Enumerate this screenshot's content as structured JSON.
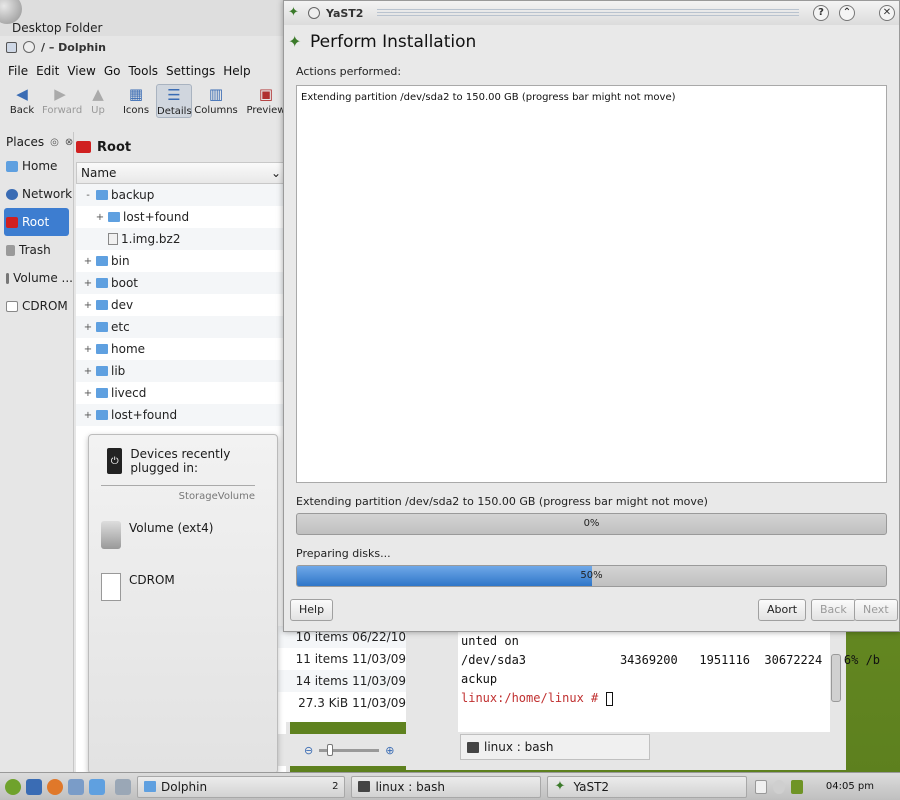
{
  "desktop_folder": {
    "title": "Desktop Folder"
  },
  "dolphin": {
    "title": "/ – Dolphin",
    "menu": [
      "File",
      "Edit",
      "View",
      "Go",
      "Tools",
      "Settings",
      "Help"
    ],
    "toolbar": {
      "back": "Back",
      "forward": "Forward",
      "up": "Up",
      "icons": "Icons",
      "details": "Details",
      "columns": "Columns",
      "preview": "Preview"
    },
    "places": {
      "title": "Places",
      "items": [
        "Home",
        "Network",
        "Root",
        "Trash",
        "Volume ...",
        "CDROM"
      ]
    },
    "location": "Root",
    "column_header": "Name",
    "tree": [
      {
        "exp": "-",
        "name": "backup",
        "type": "folder",
        "indent": 0
      },
      {
        "exp": "+",
        "name": "lost+found",
        "type": "folder",
        "indent": 1
      },
      {
        "exp": "",
        "name": "1.img.bz2",
        "type": "file",
        "indent": 1
      },
      {
        "exp": "+",
        "name": "bin",
        "type": "folder",
        "indent": 0
      },
      {
        "exp": "+",
        "name": "boot",
        "type": "folder",
        "indent": 0
      },
      {
        "exp": "+",
        "name": "dev",
        "type": "folder",
        "indent": 0
      },
      {
        "exp": "+",
        "name": "etc",
        "type": "folder",
        "indent": 0
      },
      {
        "exp": "+",
        "name": "home",
        "type": "folder",
        "indent": 0
      },
      {
        "exp": "+",
        "name": "lib",
        "type": "folder",
        "indent": 0
      },
      {
        "exp": "+",
        "name": "livecd",
        "type": "folder",
        "indent": 0
      },
      {
        "exp": "+",
        "name": "lost+found",
        "type": "folder",
        "indent": 0
      }
    ],
    "details_tail": [
      {
        "size": "10 items",
        "date": "06/22/10"
      },
      {
        "size": "11 items",
        "date": "11/03/09"
      },
      {
        "size": "14 items",
        "date": "11/03/09"
      },
      {
        "size": "27.3 KiB",
        "date": "11/03/09"
      }
    ]
  },
  "devices": {
    "header": "Devices recently plugged in:",
    "section": "StorageVolume",
    "items": [
      "Volume (ext4)",
      "CDROM"
    ]
  },
  "terminal": {
    "lines": [
      "unted on",
      "/dev/sda3             34369200   1951116  30672224   6% /b",
      "ackup"
    ],
    "prompt": "linux:/home/linux # ",
    "tab_label": "linux : bash"
  },
  "yast": {
    "window_title": "YaST2",
    "heading": "Perform Installation",
    "actions_label": "Actions performed:",
    "actions_log": "Extending partition /dev/sda2 to 150.00 GB (progress bar might not move)",
    "step_label": "Extending partition /dev/sda2 to 150.00 GB (progress bar might not move)",
    "step_progress_text": "0%",
    "step_progress": 0,
    "total_label": "Preparing disks...",
    "total_progress_text": "50%",
    "total_progress": 0.5,
    "buttons": {
      "help": "Help",
      "abort": "Abort",
      "back": "Back",
      "next": "Next"
    }
  },
  "taskbar": {
    "tasks": [
      "Dolphin",
      "linux : bash",
      "YaST2"
    ],
    "desktop_number": "2",
    "clock": "04:05 pm"
  },
  "colors": {
    "selection": "#3d7dd0",
    "progress_fill": "#2f76c8",
    "root_folder": "#d02020",
    "prompt": "#c03030"
  }
}
